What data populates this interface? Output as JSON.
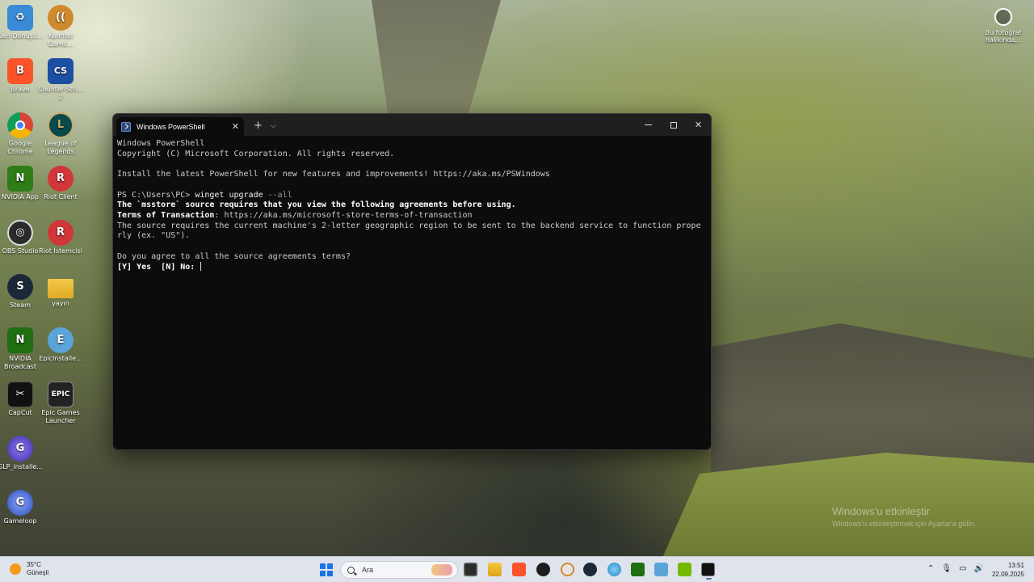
{
  "desktop": {
    "icons": [
      {
        "label": "Geri Dönüşü...",
        "glyph": "♻",
        "color": "#3a8bd6"
      },
      {
        "label": "Konfitel Gamé...",
        "glyph": "((",
        "color": "#d08a2e"
      },
      {
        "label": "Brave",
        "glyph": "B",
        "color": "#fb542b"
      },
      {
        "label": "Counter-Stri... 2",
        "glyph": "CS",
        "color": "#1d4fa3"
      },
      {
        "label": "Google Chrome",
        "glyph": "◉",
        "color": "#db4437"
      },
      {
        "label": "League of Legends",
        "glyph": "L",
        "color": "#0a4a4a"
      },
      {
        "label": "NVIDIA App",
        "glyph": "N",
        "color": "#2e7d16"
      },
      {
        "label": "Riot Client",
        "glyph": "R",
        "color": "#d13639"
      },
      {
        "label": "OBS Studio",
        "glyph": "◎",
        "color": "#2b2b2b"
      },
      {
        "label": "Riot İstemcisi",
        "glyph": "R",
        "color": "#d13639"
      },
      {
        "label": "Steam",
        "glyph": "S",
        "color": "#1b2838"
      },
      {
        "label": "yayın",
        "glyph": "▬",
        "color": "#e8b830"
      },
      {
        "label": "NVIDIA Broadcast",
        "glyph": "N",
        "color": "#1f6e12"
      },
      {
        "label": "EpicInstalle...",
        "glyph": "E",
        "color": "#5aa4d8"
      },
      {
        "label": "CapCut",
        "glyph": "✂",
        "color": "#111111"
      },
      {
        "label": "Epic Games Launcher",
        "glyph": "EPIC",
        "color": "#222222"
      },
      {
        "label": "GLP_installe...",
        "glyph": "G",
        "color": "#5f4cc8"
      },
      {
        "label": "Gameloop",
        "glyph": "G",
        "color": "#4a6fd1"
      }
    ],
    "photo_info_label": "Bu fotoğraf hakkında...",
    "watermark_title": "Windows'u etkinleştir",
    "watermark_subtitle": "Windows'u etkinleştirmek için Ayarlar'a gidin."
  },
  "window": {
    "tab_title": "Windows PowerShell",
    "new_tab": "+",
    "dropdown": "⌵",
    "close_tab": "✕",
    "minimize": "",
    "maximize": "",
    "close": "✕"
  },
  "terminal": {
    "l1": "Windows PowerShell",
    "l2": "Copyright (C) Microsoft Corporation. All rights reserved.",
    "l3": "Install the latest PowerShell for new features and improvements! https://aka.ms/PSWindows",
    "prompt": "PS C:\\Users\\PC> ",
    "cmd": "winget",
    "args": " upgrade ",
    "param": "--all",
    "l5": "The `msstore` source requires that you view the following agreements before using.",
    "l6_label": "Terms of Transaction",
    "l6_value": ": https://aka.ms/microsoft-store-terms-of-transaction",
    "l7": "The source requires the current machine's 2-letter geographic region to be sent to the backend service to function prope",
    "l8": "rly (ex. \"US\").",
    "l9": "Do you agree to all the source agreements terms?",
    "l10": "[Y] Yes  [N] No: "
  },
  "taskbar": {
    "temperature": "35°C",
    "weather": "Güneşli",
    "search_placeholder": "Ara",
    "time": "13:51",
    "date": "22.09.2025"
  },
  "colors": {
    "terminal_bg": "#0c0c0c",
    "taskbar_bg": "#dfe3ec",
    "accent": "#1a73e8"
  }
}
